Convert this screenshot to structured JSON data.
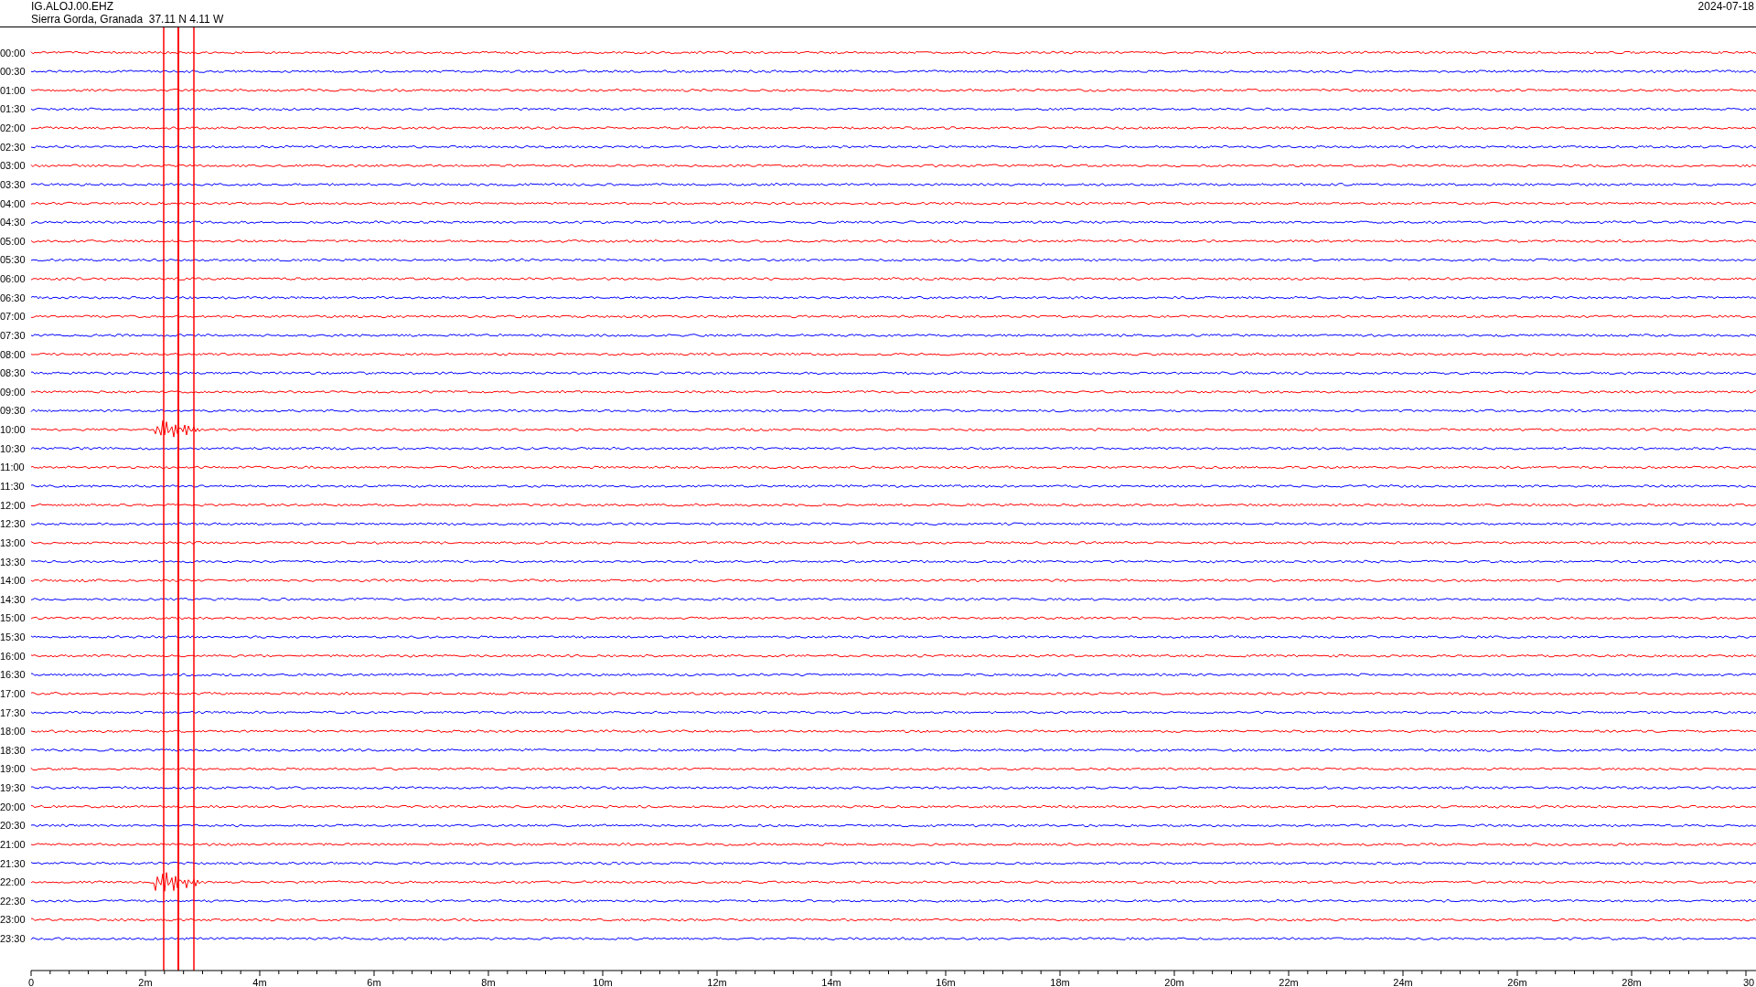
{
  "header": {
    "station": "IG.ALOJ.00.EHZ",
    "location": "Sierra Gorda, Granada  37.11 N 4.11 W",
    "date": "2024-07-18"
  },
  "rows": [
    {
      "time": "00:00",
      "color": "#ff0000",
      "event": false
    },
    {
      "time": "00:30",
      "color": "#0000ff",
      "event": false
    },
    {
      "time": "01:00",
      "color": "#ff0000",
      "event": false
    },
    {
      "time": "01:30",
      "color": "#0000ff",
      "event": false
    },
    {
      "time": "02:00",
      "color": "#ff0000",
      "event": false
    },
    {
      "time": "02:30",
      "color": "#0000ff",
      "event": false
    },
    {
      "time": "03:00",
      "color": "#ff0000",
      "event": false
    },
    {
      "time": "03:30",
      "color": "#0000ff",
      "event": false
    },
    {
      "time": "04:00",
      "color": "#ff0000",
      "event": false
    },
    {
      "time": "04:30",
      "color": "#0000ff",
      "event": false
    },
    {
      "time": "05:00",
      "color": "#ff0000",
      "event": false
    },
    {
      "time": "05:30",
      "color": "#0000ff",
      "event": false
    },
    {
      "time": "06:00",
      "color": "#ff0000",
      "event": false
    },
    {
      "time": "06:30",
      "color": "#0000ff",
      "event": false
    },
    {
      "time": "07:00",
      "color": "#ff0000",
      "event": false
    },
    {
      "time": "07:30",
      "color": "#0000ff",
      "event": false
    },
    {
      "time": "08:00",
      "color": "#ff0000",
      "event": false
    },
    {
      "time": "08:30",
      "color": "#0000ff",
      "event": false
    },
    {
      "time": "09:00",
      "color": "#ff0000",
      "event": false
    },
    {
      "time": "09:30",
      "color": "#0000ff",
      "event": false
    },
    {
      "time": "10:00",
      "color": "#ff0000",
      "event": true
    },
    {
      "time": "10:30",
      "color": "#0000ff",
      "event": false
    },
    {
      "time": "11:00",
      "color": "#ff0000",
      "event": false
    },
    {
      "time": "11:30",
      "color": "#0000ff",
      "event": false
    },
    {
      "time": "12:00",
      "color": "#ff0000",
      "event": false
    },
    {
      "time": "12:30",
      "color": "#0000ff",
      "event": false
    },
    {
      "time": "13:00",
      "color": "#ff0000",
      "event": false
    },
    {
      "time": "13:30",
      "color": "#0000ff",
      "event": false
    },
    {
      "time": "14:00",
      "color": "#ff0000",
      "event": false
    },
    {
      "time": "14:30",
      "color": "#0000ff",
      "event": false
    },
    {
      "time": "15:00",
      "color": "#ff0000",
      "event": false
    },
    {
      "time": "15:30",
      "color": "#0000ff",
      "event": false
    },
    {
      "time": "16:00",
      "color": "#ff0000",
      "event": false
    },
    {
      "time": "16:30",
      "color": "#0000ff",
      "event": false
    },
    {
      "time": "17:00",
      "color": "#ff0000",
      "event": false
    },
    {
      "time": "17:30",
      "color": "#0000ff",
      "event": false
    },
    {
      "time": "18:00",
      "color": "#ff0000",
      "event": false
    },
    {
      "time": "18:30",
      "color": "#0000ff",
      "event": false
    },
    {
      "time": "19:00",
      "color": "#ff0000",
      "event": false
    },
    {
      "time": "19:30",
      "color": "#0000ff",
      "event": false
    },
    {
      "time": "20:00",
      "color": "#ff0000",
      "event": false
    },
    {
      "time": "20:30",
      "color": "#0000ff",
      "event": false
    },
    {
      "time": "21:00",
      "color": "#ff0000",
      "event": false
    },
    {
      "time": "21:30",
      "color": "#0000ff",
      "event": false
    },
    {
      "time": "22:00",
      "color": "#ff0000",
      "event": true
    },
    {
      "time": "22:30",
      "color": "#0000ff",
      "event": false
    },
    {
      "time": "23:00",
      "color": "#ff0000",
      "event": false
    },
    {
      "time": "23:30",
      "color": "#0000ff",
      "event": false
    }
  ],
  "x_axis": {
    "ticks": [
      "0",
      "2m",
      "4m",
      "6m",
      "8m",
      "10m",
      "12m",
      "14m",
      "16m",
      "18m",
      "20m",
      "22m",
      "24m",
      "26m",
      "28m",
      "30"
    ]
  }
}
